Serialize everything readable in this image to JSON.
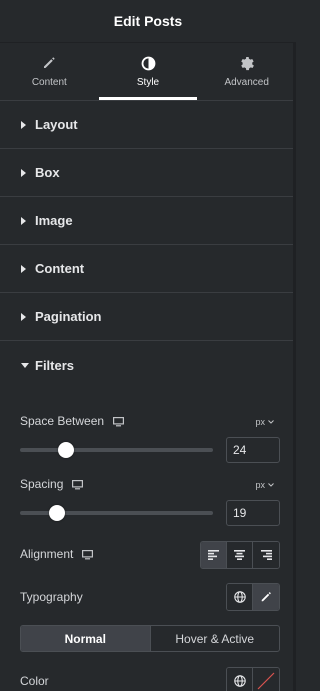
{
  "header": {
    "title": "Edit Posts"
  },
  "tabs": [
    {
      "label": "Content",
      "icon": "pencil-icon",
      "active": false
    },
    {
      "label": "Style",
      "icon": "contrast-icon",
      "active": true
    },
    {
      "label": "Advanced",
      "icon": "gear-icon",
      "active": false
    }
  ],
  "sections": [
    {
      "label": "Layout"
    },
    {
      "label": "Box"
    },
    {
      "label": "Image"
    },
    {
      "label": "Content"
    },
    {
      "label": "Pagination"
    },
    {
      "label": "Filters",
      "expanded": true
    }
  ],
  "filters": {
    "space_between": {
      "label": "Space Between",
      "unit": "px",
      "value": "24",
      "slider_fraction": 0.24
    },
    "spacing": {
      "label": "Spacing",
      "unit": "px",
      "value": "19",
      "slider_fraction": 0.19
    },
    "alignment": {
      "label": "Alignment",
      "options": [
        "align-left-icon",
        "align-center-icon",
        "align-right-icon"
      ],
      "selected": "align-left-icon"
    },
    "typography": {
      "label": "Typography"
    },
    "state_tabs": {
      "normal": "Normal",
      "hover": "Hover & Active",
      "selected": "Normal"
    },
    "color": {
      "label": "Color"
    }
  },
  "colors": {
    "background": "#26292c",
    "border": "#3a3d41",
    "active": "#404349",
    "text": "#e0e1e3"
  }
}
